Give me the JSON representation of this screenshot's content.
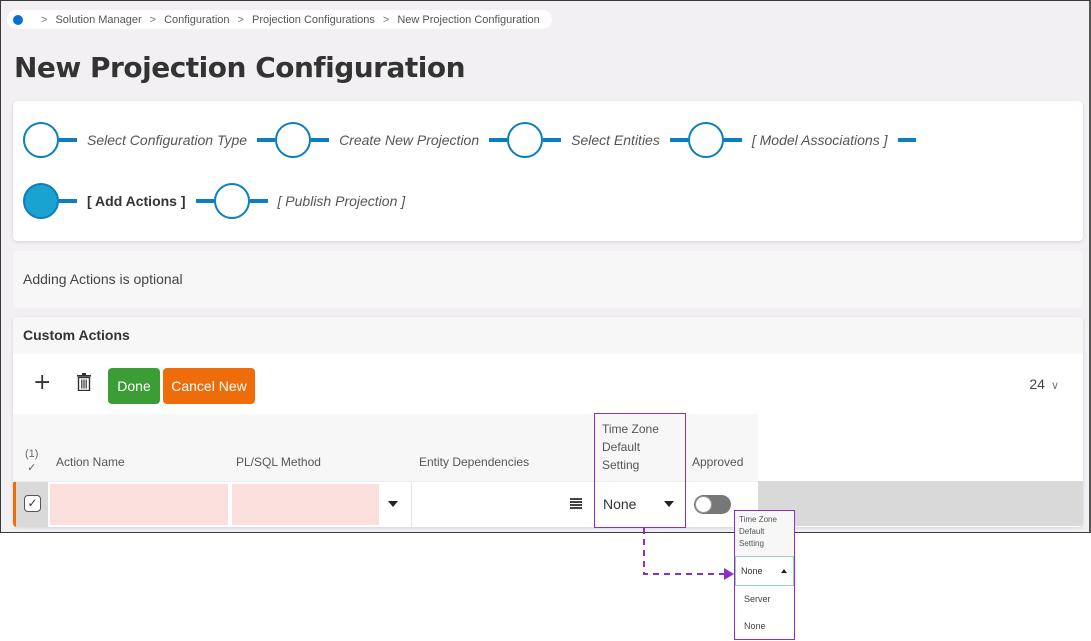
{
  "breadcrumb": {
    "home_icon": "home-dot-icon",
    "separator": ">",
    "items": [
      "Solution Manager",
      "Configuration",
      "Projection Configurations",
      "New Projection Configuration"
    ]
  },
  "page_title": "New Projection Configuration",
  "wizard": {
    "steps": [
      {
        "label": "Select Configuration Type",
        "state": "pending"
      },
      {
        "label": "Create New Projection",
        "state": "pending"
      },
      {
        "label": "Select Entities",
        "state": "pending"
      },
      {
        "label": "[ Model Associations ]",
        "state": "pending"
      },
      {
        "label": "[ Add Actions ]",
        "state": "active"
      },
      {
        "label": "[ Publish Projection ]",
        "state": "pending"
      }
    ],
    "accent_color": "#0a7ebf",
    "active_color": "#1aa3d1"
  },
  "info": {
    "text": "Adding Actions is optional"
  },
  "custom_actions": {
    "title": "Custom Actions",
    "toolbar": {
      "add_icon": "plus-icon",
      "delete_icon": "trash-icon",
      "done_label": "Done",
      "cancel_label": "Cancel New",
      "page_size": "24",
      "done_color": "#3a9d35",
      "cancel_color": "#ef6c0b"
    },
    "columns": {
      "select_count": "(1)",
      "select_check": "✓",
      "action_name": "Action Name",
      "plsql_method": "PL/SQL Method",
      "entity_dependencies": "Entity Dependencies",
      "time_zone_line1": "Time Zone",
      "time_zone_line2": "Default",
      "time_zone_line3": "Setting",
      "approved": "Approved"
    },
    "rows": [
      {
        "selected": true,
        "checkbox_glyph": "✓",
        "action_name": "",
        "plsql_method": "",
        "entity_dependencies": "",
        "time_zone": "None",
        "approved": false
      }
    ]
  },
  "callout": {
    "header_line1": "Time Zone",
    "header_line2": "Default",
    "header_line3": "Setting",
    "selected": "None",
    "options": [
      "Server",
      "None"
    ],
    "highlight_color": "#8d2fc4"
  }
}
